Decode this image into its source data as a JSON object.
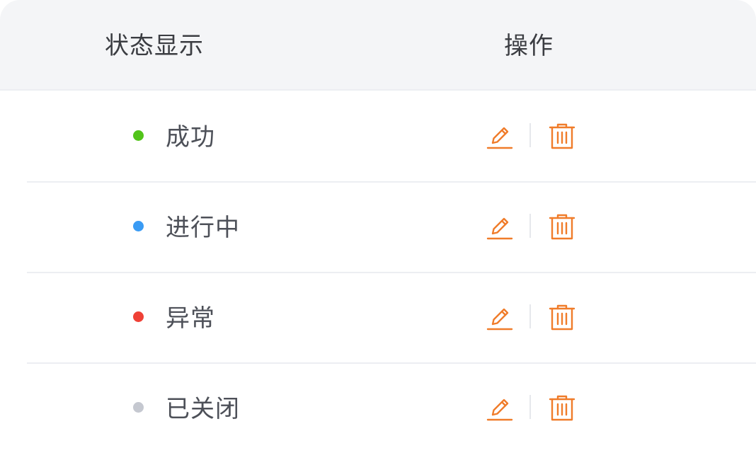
{
  "table": {
    "columns": [
      "状态显示",
      "操作"
    ],
    "rows": [
      {
        "status": "成功",
        "dot_color": "#52c41a"
      },
      {
        "status": "进行中",
        "dot_color": "#3a9bf4"
      },
      {
        "status": "异常",
        "dot_color": "#ef4136"
      },
      {
        "status": "已关闭",
        "dot_color": "#c5c8d0"
      }
    ]
  },
  "colors": {
    "accent": "#f07c2a",
    "header_bg": "#f4f5f7",
    "divider": "#eceef2"
  },
  "icons": {
    "edit": "edit-pencil-icon",
    "delete": "trash-icon"
  }
}
